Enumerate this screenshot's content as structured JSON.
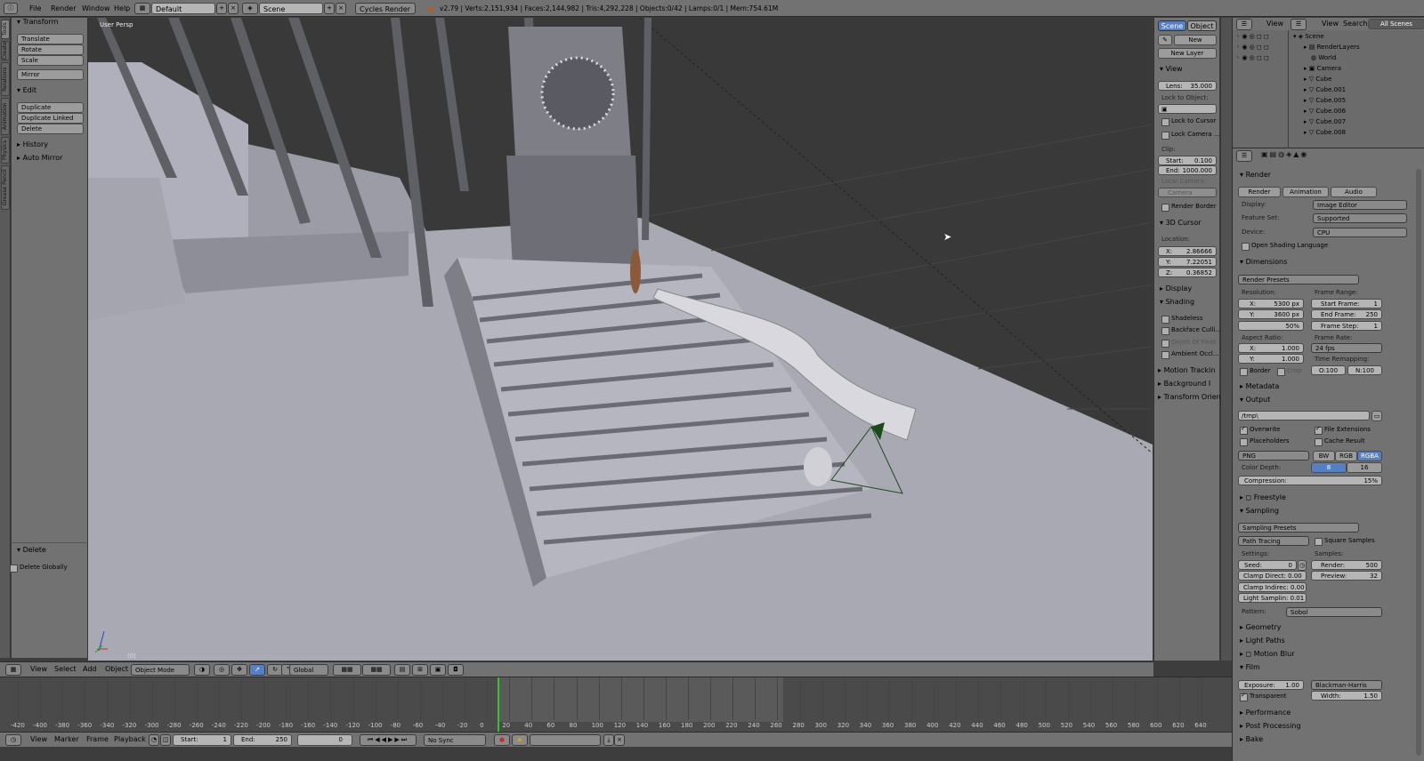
{
  "topbar": {
    "menus": [
      "File",
      "Render",
      "Window",
      "Help"
    ],
    "layout": "Default",
    "scene": "Scene",
    "engine": "Cycles Render",
    "stats": "v2.79 | Verts:2,151,934 | Faces:2,144,982 | Tris:4,292,228 | Objects:0/42 | Lamps:0/1 | Mem:754.61M"
  },
  "tabs": [
    "Tools",
    "Create",
    "Relations",
    "Animation",
    "Physics",
    "Grease Pencil"
  ],
  "toolshelf": {
    "transform_header": "Transform",
    "transform_buttons": [
      "Translate",
      "Rotate",
      "Scale"
    ],
    "mirror": "Mirror",
    "edit_header": "Edit",
    "edit_buttons": [
      "Duplicate",
      "Duplicate Linked",
      "Delete"
    ],
    "history": "History",
    "auto_mirror": "Auto Mirror",
    "operator_header": "Delete",
    "delete_globally": "Delete Globally"
  },
  "viewport": {
    "label": "User Persp",
    "frame": "(0)"
  },
  "nprops": {
    "scene_tab": "Scene",
    "object_tab": "Object",
    "new_btn": "New",
    "new_layer": "New Layer",
    "view_header": "View",
    "lens": "Lens:",
    "lens_val": "35.000",
    "lock_to_object": "Lock to Object:",
    "lock_to_cursor": "Lock to Cursor",
    "lock_camera": "Lock Camera ...",
    "clip": "Clip:",
    "clip_start": "Start:",
    "clip_start_val": "0.100",
    "clip_end": "End:",
    "clip_end_val": "1000.000",
    "local_camera": "Local Camera:",
    "camera": "Camera",
    "render_border": "Render Border",
    "cursor_header": "3D Cursor",
    "location": "Location:",
    "loc_x": "X:",
    "loc_x_val": "2.86666",
    "loc_y": "Y:",
    "loc_y_val": "7.22051",
    "loc_z": "Z:",
    "loc_z_val": "0.36852",
    "display_header": "Display",
    "shading_header": "Shading",
    "shadeless": "Shadeless",
    "backface": "Backface Culli...",
    "depth_of_field": "Depth Of Field",
    "ambient": "Ambient Occl...",
    "motion_tracking": "Motion Trackin",
    "background": "Background I",
    "transform_orient": "Transform Orienta"
  },
  "outliner": {
    "menus": [
      "View",
      "View",
      "Search",
      "All Scenes"
    ],
    "items": [
      "Scene",
      "RenderLayers",
      "World",
      "Camera",
      "Cube",
      "Cube.001",
      "Cube.005",
      "Cube.006",
      "Cube.007",
      "Cube.008"
    ]
  },
  "props": {
    "render_header": "Render",
    "render_btn": "Render",
    "animation_btn": "Animation",
    "audio_btn": "Audio",
    "display_lbl": "Display:",
    "display_val": "Image Editor",
    "feature_lbl": "Feature Set:",
    "feature_val": "Supported",
    "device_lbl": "Device:",
    "device_val": "CPU",
    "osl": "Open Shading Language",
    "dimensions_header": "Dimensions",
    "render_presets": "Render Presets",
    "resolution_lbl": "Resolution:",
    "res_x": "X:",
    "res_x_val": "5300 px",
    "res_y": "Y:",
    "res_y_val": "3600 px",
    "res_pct": "50%",
    "frame_range_lbl": "Frame Range:",
    "start_frame": "Start Frame:",
    "start_frame_val": "1",
    "end_frame": "End Frame:",
    "end_frame_val": "250",
    "frame_step": "Frame Step:",
    "frame_step_val": "1",
    "aspect_lbl": "Aspect Ratio:",
    "asp_x": "X:",
    "asp_x_val": "1.000",
    "asp_y": "Y:",
    "asp_y_val": "1.000",
    "frame_rate_lbl": "Frame Rate:",
    "frame_rate_val": "24 fps",
    "time_remap_lbl": "Time Remapping:",
    "remap_old": "O:100",
    "remap_new": "N:100",
    "border": "Border",
    "crop": "Crop",
    "metadata_header": "Metadata",
    "output_header": "Output",
    "output_path": "/tmp\\",
    "overwrite": "Overwrite",
    "file_extensions": "File Extensions",
    "placeholders": "Placeholders",
    "cache_result": "Cache Result",
    "format": "PNG",
    "bw": "BW",
    "rgb": "RGB",
    "rgba": "RGBA",
    "color_depth_lbl": "Color Depth:",
    "depth_8": "8",
    "depth_16": "16",
    "compression": "Compression:",
    "compression_val": "15%",
    "freestyle_header": "Freestyle",
    "sampling_header": "Sampling",
    "sampling_presets": "Sampling Presets",
    "integrator": "Path Tracing",
    "square_samples": "Square Samples",
    "settings_lbl": "Settings:",
    "samples_lbl": "Samples:",
    "seed": "Seed:",
    "seed_val": "0",
    "clamp_direct": "Clamp Direct: 0.00",
    "clamp_indirect": "Clamp Indirec: 0.00",
    "light_sampling": "Light Samplin: 0.01",
    "render_samples": "Render:",
    "render_samples_val": "500",
    "preview_samples": "Preview:",
    "preview_samples_val": "32",
    "pattern_lbl": "Pattern:",
    "pattern_val": "Sobol",
    "geometry_header": "Geometry",
    "light_paths_header": "Light Paths",
    "motion_blur_header": "Motion Blur",
    "film_header": "Film",
    "exposure": "Exposure:",
    "exposure_val": "1.00",
    "filter": "Blackman-Harris",
    "transparent": "Transparent",
    "width": "Width:",
    "width_val": "1.50",
    "performance_header": "Performance",
    "post_processing_header": "Post Processing",
    "bake_header": "Bake"
  },
  "vphead": {
    "menus": [
      "View",
      "Select",
      "Add",
      "Object"
    ],
    "mode": "Object Mode",
    "orientation": "Global"
  },
  "timeline": {
    "ruler": [
      "-420",
      "-400",
      "-380",
      "-360",
      "-340",
      "-320",
      "-300",
      "-280",
      "-260",
      "-240",
      "-220",
      "-200",
      "-180",
      "-160",
      "-140",
      "-120",
      "-100",
      "-80",
      "-60",
      "-40",
      "-20",
      "0",
      "20",
      "40",
      "60",
      "80",
      "100",
      "120",
      "140",
      "160",
      "180",
      "200",
      "220",
      "240",
      "260",
      "280",
      "300",
      "320",
      "340",
      "360",
      "380",
      "400",
      "420",
      "440",
      "460",
      "480",
      "500",
      "520",
      "540",
      "560",
      "580",
      "600",
      "620",
      "640"
    ],
    "menus": [
      "View",
      "Marker",
      "Frame",
      "Playback"
    ],
    "start": "Start:",
    "start_val": "1",
    "end": "End:",
    "end_val": "250",
    "current": "0",
    "sync": "No Sync"
  },
  "colors": {
    "selected_blue": "#5680c2",
    "viewport_floor": "#a9a9b3",
    "viewport_bg": "#393939"
  }
}
